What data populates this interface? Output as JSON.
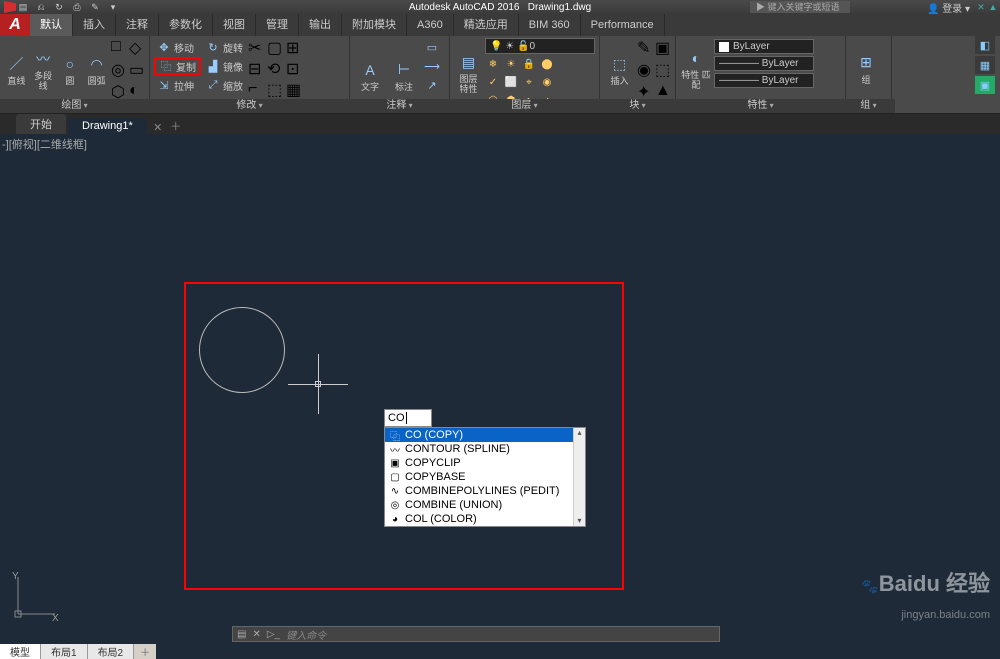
{
  "app": {
    "title": "Autodesk AutoCAD 2016",
    "doc": "Drawing1.dwg",
    "search_placeholder": "键入关键字或短语",
    "login": "登录"
  },
  "qat": [
    "▤",
    "⎌",
    "↻",
    "⎙",
    "✎",
    "▾"
  ],
  "ribbon_tabs": [
    {
      "label": "默认",
      "active": true
    },
    {
      "label": "插入"
    },
    {
      "label": "注释"
    },
    {
      "label": "参数化"
    },
    {
      "label": "视图"
    },
    {
      "label": "管理"
    },
    {
      "label": "输出"
    },
    {
      "label": "附加模块"
    },
    {
      "label": "A360"
    },
    {
      "label": "精选应用"
    },
    {
      "label": "BIM 360"
    },
    {
      "label": "Performance"
    }
  ],
  "panels": {
    "draw": {
      "title": "绘图",
      "items": [
        {
          "label": "直线",
          "icon": "／"
        },
        {
          "label": "多段线",
          "icon": "〰"
        },
        {
          "label": "圆",
          "icon": "○"
        },
        {
          "label": "圆弧",
          "icon": "◠"
        }
      ],
      "small": [
        "□",
        "◇",
        "◎",
        "▭",
        "⬡",
        "◐"
      ]
    },
    "modify": {
      "title": "修改",
      "col1": [
        {
          "icon": "✥",
          "label": "移动"
        },
        {
          "icon": "⿻",
          "label": "复制",
          "hl": true
        },
        {
          "icon": "⇲",
          "label": "拉伸"
        }
      ],
      "col2": [
        {
          "icon": "↻",
          "label": "旋转"
        },
        {
          "icon": "▟",
          "label": "镜像"
        },
        {
          "icon": "⤢",
          "label": "缩放"
        }
      ],
      "col3": [
        "✂",
        "▢",
        "⊞",
        "⊟",
        "⟲",
        "⊡",
        "⌐",
        "⬚",
        "▦"
      ]
    },
    "annotate": {
      "title": "注释",
      "text": "文字",
      "dim": "标注",
      "icons": [
        "A",
        "⊢",
        "▭",
        "⟶",
        "↗",
        "⊞"
      ]
    },
    "layers": {
      "title": "图层",
      "main": "图层\n特性",
      "selected": "0",
      "grid": [
        "❄",
        "☀",
        "🔒",
        "⬤",
        "✓",
        "⬜",
        "⌖",
        "◉",
        "⬡",
        "⬢",
        "◐",
        "◑"
      ]
    },
    "block": {
      "title": "块",
      "label": "插入",
      "icons": [
        "✎",
        "▣",
        "◉",
        "⬚",
        "✦",
        "▲"
      ]
    },
    "props": {
      "title": "特性",
      "label": "特性\n匹配",
      "combos": [
        "ByLayer",
        "———— ByLayer",
        "———— ByLayer"
      ]
    },
    "group": {
      "title": "组",
      "label": "组"
    }
  },
  "filetabs": [
    {
      "label": "开始"
    },
    {
      "label": "Drawing1*",
      "active": true
    }
  ],
  "viewport_label": "-][俯视][二维线框]",
  "command_input": "CO",
  "autocomplete": [
    {
      "icon": "⿻",
      "label": "CO (COPY)",
      "sel": true
    },
    {
      "icon": "〰",
      "label": "CONTOUR (SPLINE)"
    },
    {
      "icon": "▣",
      "label": "COPYCLIP"
    },
    {
      "icon": "▢",
      "label": "COPYBASE"
    },
    {
      "icon": "∿",
      "label": "COMBINEPOLYLINES (PEDIT)"
    },
    {
      "icon": "◎",
      "label": "COMBINE (UNION)"
    },
    {
      "icon": "◕",
      "label": "COL (COLOR)"
    }
  ],
  "cmdline_prompt": "键入命令",
  "bottomtabs": [
    {
      "label": "模型",
      "active": true
    },
    {
      "label": "布局1"
    },
    {
      "label": "布局2"
    }
  ],
  "watermark": {
    "brand": "Baidu 经验",
    "url": "jingyan.baidu.com"
  },
  "ucs": {
    "x": "X",
    "y": "Y"
  }
}
